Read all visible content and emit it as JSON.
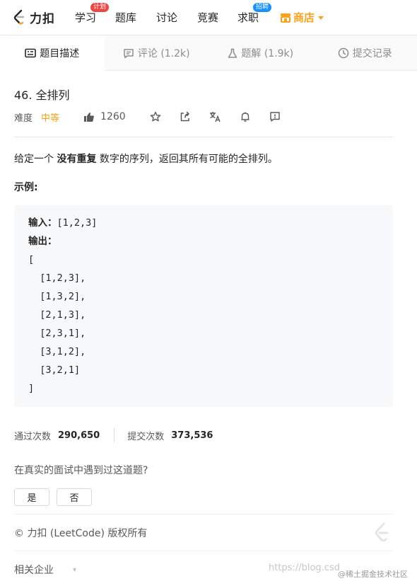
{
  "nav": {
    "logo_text": "力扣",
    "items": [
      {
        "label": "学习",
        "badge": "计划"
      },
      {
        "label": "题库"
      },
      {
        "label": "讨论"
      },
      {
        "label": "竞赛"
      },
      {
        "label": "求职",
        "badge": "招聘"
      }
    ],
    "shop_label": "商店"
  },
  "tabs": [
    {
      "label": "题目描述",
      "icon": "description-icon"
    },
    {
      "label": "评论 (1.2k)",
      "icon": "comment-icon"
    },
    {
      "label": "题解 (1.9k)",
      "icon": "flask-icon"
    },
    {
      "label": "提交记录",
      "icon": "history-icon"
    }
  ],
  "problem": {
    "title": "46. 全排列",
    "difficulty_label": "难度",
    "difficulty": "中等",
    "likes": "1260",
    "desc_pre": "给定一个 ",
    "desc_bold": "没有重复",
    "desc_post": " 数字的序列，返回其所有可能的全排列。",
    "example_title": "示例:"
  },
  "example": {
    "input_label": "输入：",
    "input_value": "[1,2,3]",
    "output_label": "输出：",
    "output_lines": [
      "[",
      "  [1,2,3],",
      "  [1,3,2],",
      "  [2,1,3],",
      "  [2,3,1],",
      "  [3,1,2],",
      "  [3,2,1]",
      "]"
    ]
  },
  "stats": {
    "accepted_label": "通过次数",
    "accepted_value": "290,650",
    "submissions_label": "提交次数",
    "submissions_value": "373,536"
  },
  "interview": {
    "question": "在真实的面试中遇到过这道题?",
    "yes": "是",
    "no": "否"
  },
  "footer": {
    "copyright": "© 力扣 (LeetCode) 版权所有",
    "related": "相关企业",
    "watermark_url": "https://blog.csd",
    "watermark_site": "@稀土掘金技术社区"
  },
  "colors": {
    "accent": "#ffa116",
    "badge_pink": "#ef4743",
    "badge_blue": "#1890ff"
  }
}
